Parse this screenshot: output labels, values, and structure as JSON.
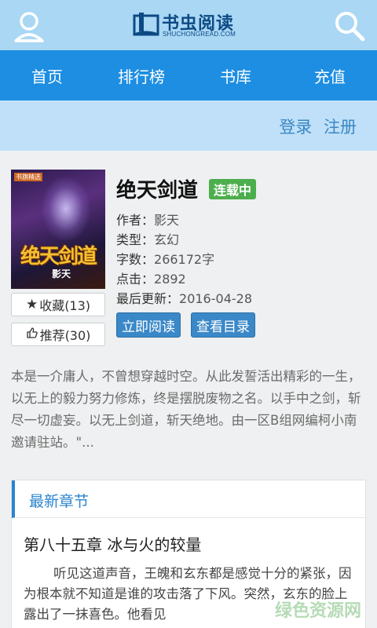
{
  "header": {
    "logo_title": "书虫阅读",
    "logo_sub": "SHUCHONGREAD.COM"
  },
  "nav": {
    "items": [
      {
        "label": "首页"
      },
      {
        "label": "排行榜"
      },
      {
        "label": "书库"
      },
      {
        "label": "充值"
      }
    ]
  },
  "auth": {
    "login": "登录",
    "register": "注册"
  },
  "book": {
    "cover": {
      "tag": "书旗精选",
      "title": "绝天剑道",
      "author": "影天"
    },
    "title": "绝天剑道",
    "status": "连载中",
    "author_label": "作者：",
    "author": "影天",
    "genre_label": "类型：",
    "genre": "玄幻",
    "words_label": "字数：",
    "words": "266172字",
    "clicks_label": "点击：",
    "clicks": "2892",
    "updated_label": "最后更新：",
    "updated": "2016-04-28",
    "favorite_label": "收藏(13)",
    "recommend_label": "推荐(30)",
    "read_button": "立即阅读",
    "toc_button": "查看目录",
    "intro": "本是一介庸人，不曾想穿越时空。从此发誓活出精彩的一生，以无上的毅力努力修炼，终是摆脱废物之名。以手中之剑，斩尽一切虚妄。以无上剑道，斩天绝地。由一区B组网编柯小南邀请驻站。\"..."
  },
  "latest": {
    "heading": "最新章节",
    "chapter_title": "第八十五章 冰与火的较量",
    "chapter_text": "听见这道声音，王魄和玄东都是感觉十分的紧张，因为根本就不知道是谁的攻击落了下风。突然，玄东的脸上露出了一抹喜色。他看见"
  },
  "watermark": "绿色资源网",
  "colors": {
    "topbar": "#a9d7f4",
    "nav": "#1d8ee2",
    "authbar": "#bfe0f8",
    "accent": "#2a84cf",
    "status_green": "#4cae4c"
  }
}
